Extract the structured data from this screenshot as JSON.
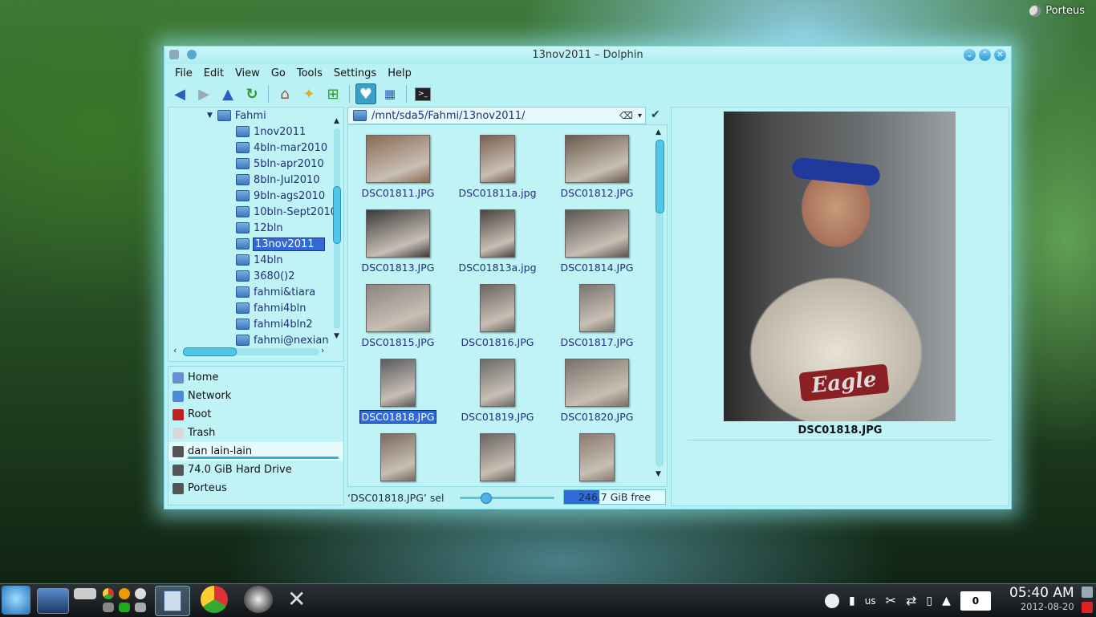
{
  "desktop": {
    "user_label": "Porteus"
  },
  "window": {
    "title": "13nov2011 – Dolphin",
    "menu": [
      "File",
      "Edit",
      "View",
      "Go",
      "Tools",
      "Settings",
      "Help"
    ]
  },
  "tree": {
    "parent": "Fahmi",
    "folders": [
      "1nov2011",
      "4bln-mar2010",
      "5bln-apr2010",
      "8bln-Jul2010",
      "9bln-ags2010",
      "10bln-Sept2010",
      "12bln",
      "13nov2011",
      "14bln",
      "3680()2",
      "fahmi&tiara",
      "fahmi4bln",
      "fahmi4bln2",
      "fahmi@nexian"
    ],
    "selected": "13nov2011"
  },
  "places": [
    {
      "label": "Home",
      "color": "#6a8fd0"
    },
    {
      "label": "Network",
      "color": "#4a8ad8"
    },
    {
      "label": "Root",
      "color": "#c02020"
    },
    {
      "label": "Trash",
      "color": "#d8d8d8"
    },
    {
      "label": "dan lain-lain",
      "color": "#555"
    },
    {
      "label": "74.0 GiB Hard Drive",
      "color": "#555"
    },
    {
      "label": "Porteus",
      "color": "#555"
    }
  ],
  "path": {
    "value": "/mnt/sda5/Fahmi/13nov2011/"
  },
  "files": [
    {
      "name": "DSC01811.JPG",
      "shape": "l",
      "color": "#8a6a55"
    },
    {
      "name": "DSC01811a.jpg",
      "shape": "p",
      "color": "#7a6050"
    },
    {
      "name": "DSC01812.JPG",
      "shape": "l",
      "color": "#6a5a4a"
    },
    {
      "name": "DSC01813.JPG",
      "shape": "l",
      "color": "#3a3a3a"
    },
    {
      "name": "DSC01813a.jpg",
      "shape": "p",
      "color": "#4a4540"
    },
    {
      "name": "DSC01814.JPG",
      "shape": "l",
      "color": "#5a5550"
    },
    {
      "name": "DSC01815.JPG",
      "shape": "l",
      "color": "#8a8580"
    },
    {
      "name": "DSC01816.JPG",
      "shape": "p",
      "color": "#6a6560"
    },
    {
      "name": "DSC01817.JPG",
      "shape": "p",
      "color": "#7a7570"
    },
    {
      "name": "DSC01818.JPG",
      "shape": "p",
      "color": "#5a5a60"
    },
    {
      "name": "DSC01819.JPG",
      "shape": "p",
      "color": "#6a6a68"
    },
    {
      "name": "DSC01820.JPG",
      "shape": "l",
      "color": "#7a7068"
    },
    {
      "name": "",
      "shape": "p",
      "color": "#7a6a60"
    },
    {
      "name": "",
      "shape": "p",
      "color": "#6a6460"
    },
    {
      "name": "",
      "shape": "p",
      "color": "#8a7a70"
    }
  ],
  "selected_file": "DSC01818.JPG",
  "status": {
    "text": "‘DSC01818.JPG’ sel",
    "free": "246.7 GiB free",
    "free_fill_fraction": 0.35,
    "zoom_fraction": 0.27
  },
  "preview": {
    "name": "DSC01818.JPG",
    "shirt_text": "Eagle"
  },
  "taskbar": {
    "layout": "us",
    "notifications": "0",
    "time": "05:40 AM",
    "date": "2012-08-20"
  }
}
